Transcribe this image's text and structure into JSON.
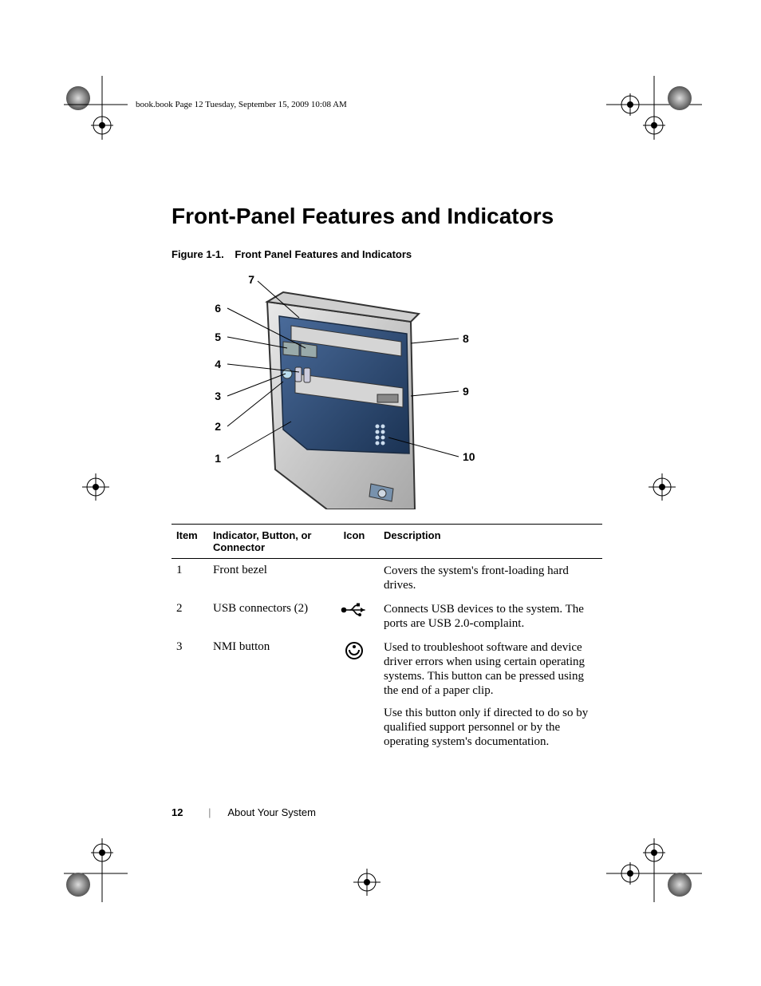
{
  "header_slug": "book.book  Page 12  Tuesday, September 15, 2009  10:08 AM",
  "section_title": "Front-Panel Features and Indicators",
  "figure": {
    "number": "Figure 1-1.",
    "title": "Front Panel Features and Indicators",
    "callouts_left": {
      "1": "1",
      "2": "2",
      "3": "3",
      "4": "4",
      "5": "5",
      "6": "6",
      "7": "7"
    },
    "callouts_right": {
      "8": "8",
      "9": "9",
      "10": "10"
    }
  },
  "table": {
    "headers": {
      "item": "Item",
      "indicator": "Indicator, Button, or Connector",
      "icon": "Icon",
      "description": "Description"
    },
    "rows": [
      {
        "item": "1",
        "indicator": "Front bezel",
        "icon": "none",
        "description": [
          "Covers the system's front-loading hard drives."
        ]
      },
      {
        "item": "2",
        "indicator": "USB connectors (2)",
        "icon": "usb",
        "description": [
          "Connects USB devices to the system. The ports are USB 2.0-complaint."
        ]
      },
      {
        "item": "3",
        "indicator": "NMI button",
        "icon": "nmi",
        "description": [
          "Used to troubleshoot software and device driver errors when using certain operating systems. This button can be pressed using the end of a paper clip.",
          "Use this button only if directed to do so by qualified support personnel or by the operating system's documentation."
        ]
      }
    ]
  },
  "chart_data": {
    "type": "table",
    "title": "Front Panel Features and Indicators",
    "columns": [
      "Item",
      "Indicator, Button, or Connector",
      "Icon",
      "Description"
    ],
    "rows": [
      [
        "1",
        "Front bezel",
        "",
        "Covers the system's front-loading hard drives."
      ],
      [
        "2",
        "USB connectors (2)",
        "usb-icon",
        "Connects USB devices to the system. The ports are USB 2.0-complaint."
      ],
      [
        "3",
        "NMI button",
        "nmi-icon",
        "Used to troubleshoot software and device driver errors when using certain operating systems. This button can be pressed using the end of a paper clip. Use this button only if directed to do so by qualified support personnel or by the operating system's documentation."
      ]
    ]
  },
  "footer": {
    "page_number": "12",
    "section_path": "About Your System"
  }
}
